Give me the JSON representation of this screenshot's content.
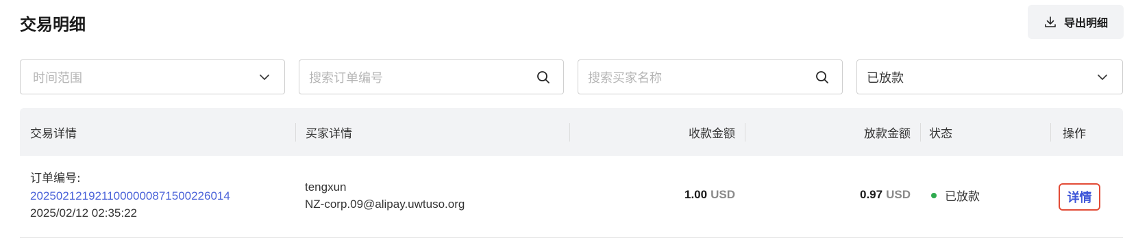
{
  "header": {
    "title": "交易明细",
    "export_label": "导出明细"
  },
  "filters": {
    "time_range_placeholder": "时间范围",
    "order_search_placeholder": "搜索订单编号",
    "buyer_search_placeholder": "搜索买家名称",
    "status_value": "已放款"
  },
  "table": {
    "columns": [
      "交易详情",
      "买家详情",
      "收款金额",
      "放款金额",
      "状态",
      "操作"
    ],
    "rows": [
      {
        "order_label": "订单编号:",
        "order_no": "2025021219211000000871500226014",
        "datetime": "2025/02/12 02:35:22",
        "buyer_name": "tengxun",
        "buyer_email": "NZ-corp.09@alipay.uwtuso.org",
        "received_amount": "1.00",
        "received_currency": "USD",
        "released_amount": "0.97",
        "released_currency": "USD",
        "status": "已放款",
        "action": "详情"
      }
    ]
  },
  "colors": {
    "link": "#4b63d9",
    "status_dot": "#2faa4f",
    "highlight_border": "#e24b36",
    "header_bg": "#f2f3f5"
  },
  "icons": {
    "export": "download-icon",
    "dropdown": "chevron-down-icon",
    "search": "search-icon"
  }
}
